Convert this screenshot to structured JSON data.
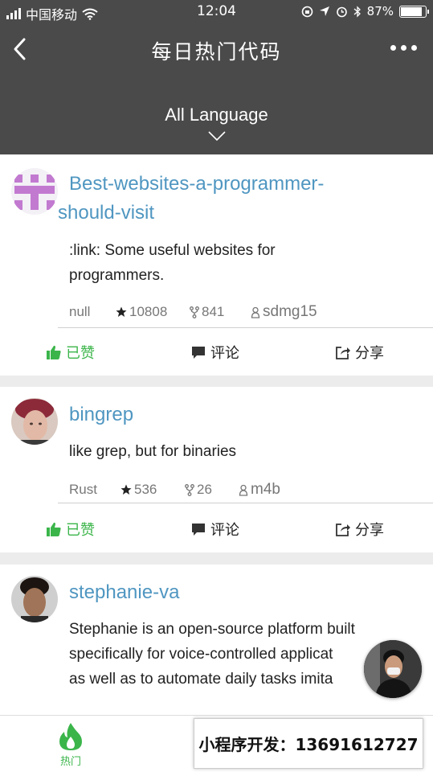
{
  "status": {
    "carrier": "中国移动",
    "time": "12:04",
    "battery": "87%",
    "battery_level": 0.87
  },
  "nav": {
    "title": "每日热门代码"
  },
  "language": {
    "label": "All Language"
  },
  "repos": [
    {
      "name_line1": "Best-websites-a-programmer-",
      "name_line2": "should-visit",
      "desc_line1": ":link: Some useful websites for",
      "desc_line2": "programmers.",
      "lang": "null",
      "stars": "10808",
      "forks": "841",
      "author": "sdmg15",
      "like": "已赞",
      "comment": "评论",
      "share": "分享"
    },
    {
      "name_line1": "bingrep",
      "desc_line1": "like grep, but for binaries",
      "lang": "Rust",
      "stars": "536",
      "forks": "26",
      "author": "m4b",
      "like": "已赞",
      "comment": "评论",
      "share": "分享"
    },
    {
      "name_line1": "stephanie-va",
      "desc_line1": "Stephanie is an open-source platform built",
      "desc_line2": "specifically for voice-controlled applicat",
      "desc_line3": "as well as to automate daily tasks imita"
    }
  ],
  "tabbar": {
    "hot": "热门"
  },
  "ad": {
    "text": "小程序开发：13691612727"
  },
  "colors": {
    "header": "#4a4a4a",
    "link": "#4f96c1",
    "liked": "#3bb54a"
  }
}
